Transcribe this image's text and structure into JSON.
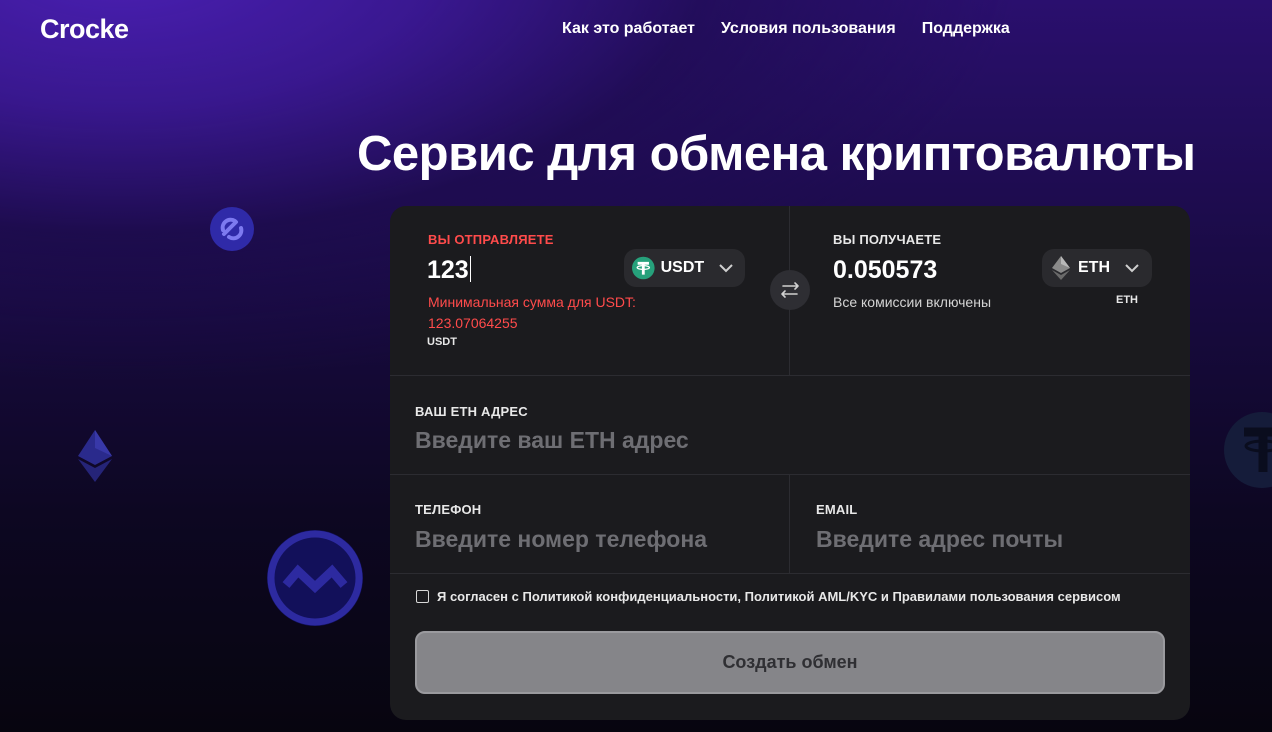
{
  "header": {
    "logo": "Crocke",
    "nav": [
      "Как это работает",
      "Условия пользования",
      "Поддержка"
    ]
  },
  "hero": {
    "title": "Сервис для обмена криптовалюты"
  },
  "send": {
    "label": "ВЫ ОТПРАВЛЯЕТЕ",
    "amount": "123",
    "currency": "USDT",
    "currency_icon": "tether-icon",
    "error": "Минимальная сумма для USDT: 123.07064255",
    "network": "USDT"
  },
  "receive": {
    "label": "ВЫ ПОЛУЧАЕТЕ",
    "amount": "0.050573",
    "note": "Все комиссии включены",
    "currency": "ETH",
    "currency_icon": "ethereum-icon",
    "network": "ETH"
  },
  "address": {
    "label": "ВАШ ETH АДРЕС",
    "placeholder": "Введите ваш ETH адрес"
  },
  "phone": {
    "label": "ТЕЛЕФОН",
    "placeholder": "Введите номер телефона"
  },
  "email": {
    "label": "EMAIL",
    "placeholder": "Введите адрес почты"
  },
  "agreement": {
    "text": "Я согласен с Политикой конфиденциальности, Политикой AML/KYC  и Правилами пользования сервисом",
    "checked": false
  },
  "submit": {
    "label": "Создать обмен"
  },
  "colors": {
    "accent_red": "#ff4b4b",
    "card_bg": "#1b1b1e",
    "tether_green": "#26a17b",
    "button_bg": "#858589"
  }
}
